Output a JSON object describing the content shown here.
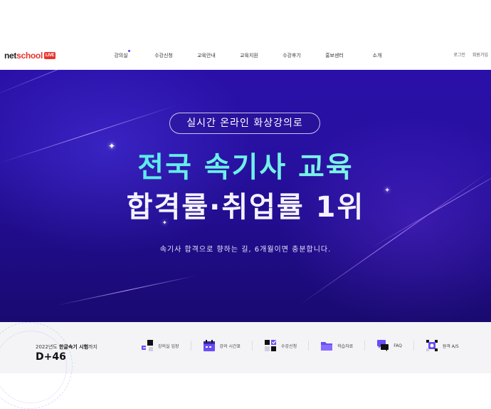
{
  "header": {
    "logo": {
      "part1": "net",
      "part2": "school",
      "badge": "LIVE"
    },
    "nav": [
      "강의실",
      "수강신청",
      "교육안내",
      "교육지원",
      "수강후기",
      "홍보센터",
      "소개"
    ],
    "util": [
      "로그인",
      "회원가입"
    ]
  },
  "hero": {
    "pill": "실시간 온라인 화상강의로",
    "headline1": "전국 속기사 교육",
    "headline2": "합격률·취업률 1위",
    "subtitle": "속기사 합격으로 향하는 길, 6개월이면 충분합니다."
  },
  "bottom": {
    "exam_year": "2022년도",
    "exam_name": "한글속기 시험",
    "exam_suffix": "까지",
    "dday_label": "D+",
    "dday_value": "46",
    "links": [
      {
        "label": "강의실 입장",
        "icon": "classroom-enter-icon"
      },
      {
        "label": "강의 시간표",
        "icon": "timetable-icon"
      },
      {
        "label": "수강신청",
        "icon": "enroll-icon"
      },
      {
        "label": "학습자료",
        "icon": "folder-icon"
      },
      {
        "label": "FAQ",
        "icon": "chat-bubbles-icon"
      },
      {
        "label": "원격 A/S",
        "icon": "remote-support-icon"
      }
    ]
  },
  "colors": {
    "accent": "#5b3df5",
    "hero_bg": "#2710a0",
    "headline_cyan": "#3fe3e9",
    "logo_red": "#e8332c"
  }
}
